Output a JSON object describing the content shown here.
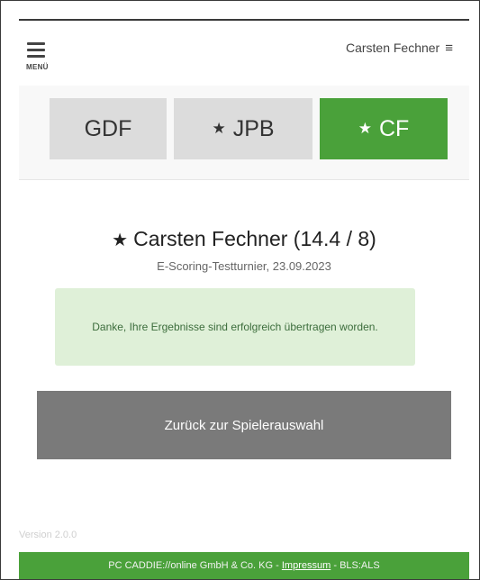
{
  "header": {
    "menu_label": "MENÜ",
    "user_name": "Carsten Fechner",
    "user_menu_icon": "≡"
  },
  "tabs": [
    {
      "label": "GDF",
      "starred": false,
      "active": false
    },
    {
      "label": "JPB",
      "starred": true,
      "active": false
    },
    {
      "label": "CF",
      "starred": true,
      "active": true
    }
  ],
  "player": {
    "title": "Carsten Fechner (14.4 / 8)",
    "subtitle": "E-Scoring-Testturnier, 23.09.2023"
  },
  "alert": {
    "message": "Danke, Ihre Ergebnisse sind erfolgreich übertragen worden."
  },
  "back_button": {
    "label": "Zurück zur Spielerauswahl"
  },
  "version": "Version 2.0.0",
  "footer": {
    "company": "PC CADDIE://online GmbH & Co. KG",
    "separator": "-",
    "impressum": "Impressum",
    "suffix": "BLS:ALS"
  },
  "colors": {
    "accent_green": "#4aa13a",
    "alert_bg": "#dff0d8",
    "button_gray": "#7a7a7a",
    "tab_gray": "#dcdcdc"
  }
}
